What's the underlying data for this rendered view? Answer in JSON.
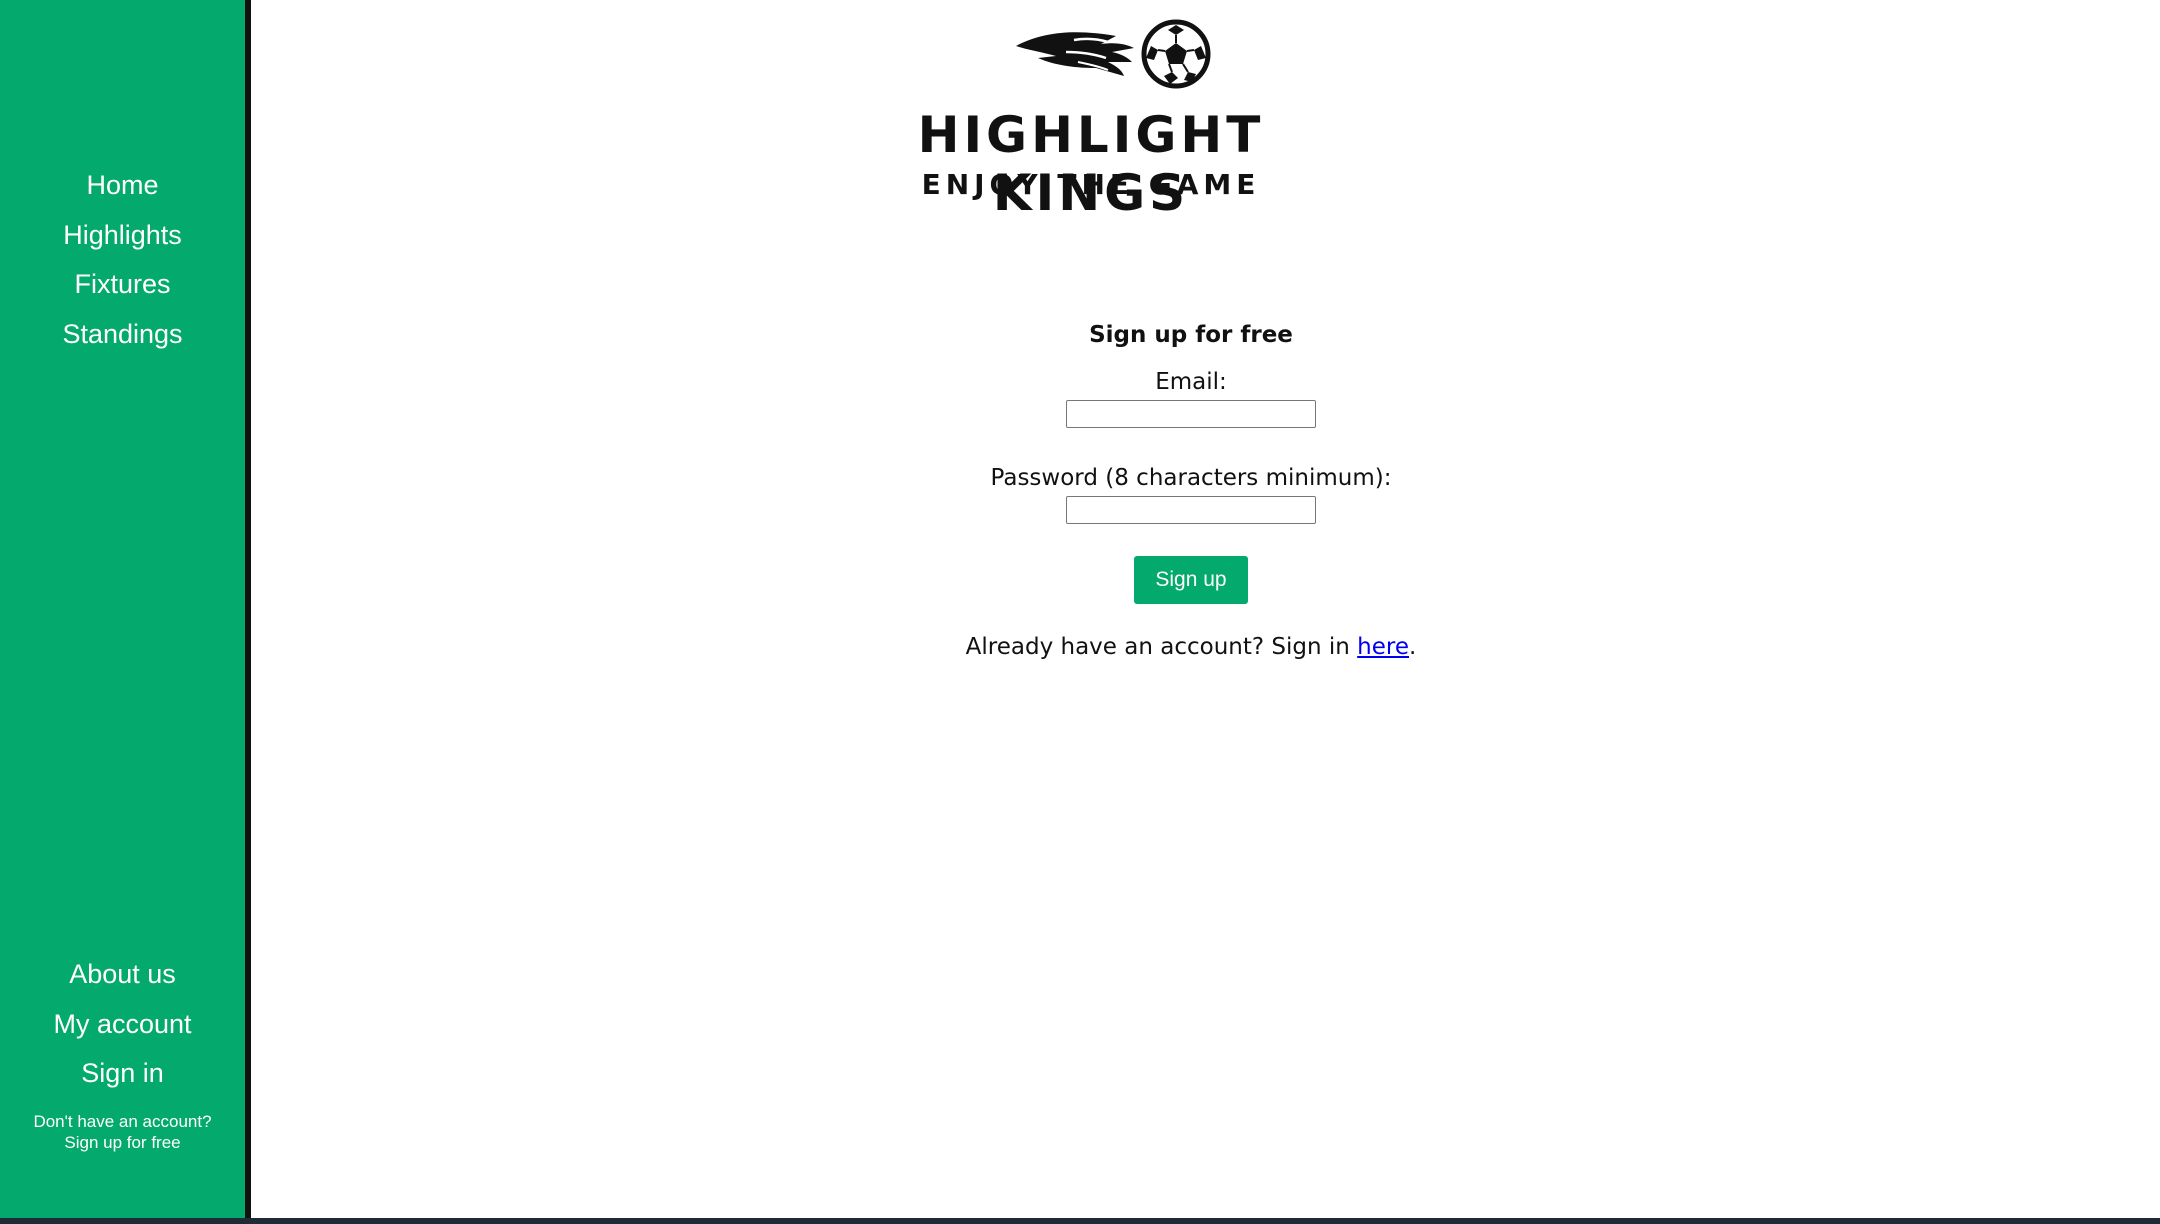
{
  "sidebar": {
    "top_items": [
      {
        "label": "Home"
      },
      {
        "label": "Highlights"
      },
      {
        "label": "Fixtures"
      },
      {
        "label": "Standings"
      }
    ],
    "bottom_items": [
      {
        "label": "About us"
      },
      {
        "label": "My account"
      },
      {
        "label": "Sign in"
      }
    ],
    "signup_note_line1": "Don't have an account?",
    "signup_note_line2": "Sign up for free"
  },
  "logo": {
    "title": "HIGHLIGHT KINGS",
    "subtitle": "ENJOY THE GAME",
    "icon": "soccer-ball-icon"
  },
  "form": {
    "title": "Sign up for free",
    "email_label": "Email:",
    "email_value": "",
    "password_label": "Password (8 characters minimum):",
    "password_value": "",
    "submit_label": "Sign up",
    "signin_prefix": "Already have an account? Sign in ",
    "signin_link": "here",
    "signin_suffix": "."
  },
  "colors": {
    "brand_green": "#04a96d",
    "sidebar_border": "#111111",
    "link_blue": "#0000ee"
  }
}
